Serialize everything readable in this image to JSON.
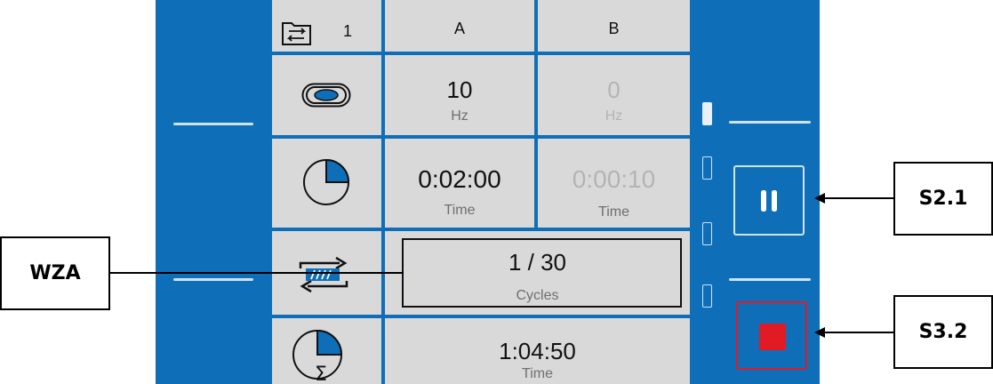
{
  "header": {
    "program_number": "1",
    "col_a_label": "A",
    "col_b_label": "B"
  },
  "rows": {
    "frequency": {
      "icon": "vibration-icon",
      "a_value": "10",
      "a_unit": "Hz",
      "b_value": "0",
      "b_unit": "Hz"
    },
    "duration": {
      "icon": "clock-icon",
      "a_value": "0:02:00",
      "a_unit": "Time",
      "b_value": "0:00:10",
      "b_unit": "Time"
    },
    "cycles": {
      "icon": "cycle-arrows-icon",
      "value": "1 / 30",
      "unit": "Cycles"
    },
    "total": {
      "icon": "total-time-icon",
      "value": "1:04:50",
      "unit": "Time"
    }
  },
  "callouts": {
    "wza": "WZA",
    "s21": "S2.1",
    "s32": "S3.2"
  },
  "colors": {
    "panel_blue": "#0e6fb8",
    "cell_gray": "#d9d9d9",
    "stop_red": "#e01b24"
  }
}
